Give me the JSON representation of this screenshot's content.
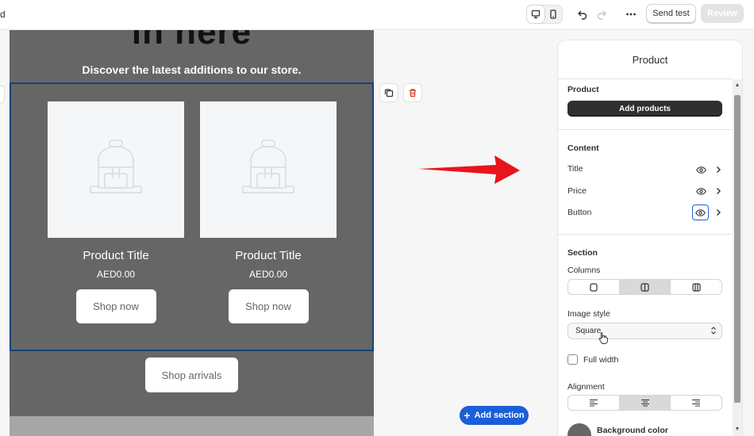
{
  "topbar": {
    "left_fragment": "d",
    "send_test_label": "Send test",
    "review_label": "Review"
  },
  "email": {
    "heading_fragment": "in here",
    "subheading": "Discover the latest additions to our store.",
    "products": [
      {
        "title": "Product Title",
        "price": "AED0.00",
        "button": "Shop now"
      },
      {
        "title": "Product Title",
        "price": "AED0.00",
        "button": "Shop now"
      }
    ],
    "arrivals_button": "Shop arrivals"
  },
  "canvas": {
    "add_section_label": "Add section"
  },
  "panel": {
    "title": "Product",
    "product_section_label": "Product",
    "add_products_label": "Add products",
    "content_section_label": "Content",
    "content_rows": [
      "Title",
      "Price",
      "Button"
    ],
    "section_label": "Section",
    "columns_label": "Columns",
    "columns_selected": 2,
    "image_style_label": "Image style",
    "image_style_value": "Square",
    "full_width_label": "Full width",
    "full_width_checked": false,
    "alignment_label": "Alignment",
    "alignment_selected": "center",
    "background_color_label": "Background color",
    "background_color_value": "#666666"
  },
  "colors": {
    "accent": "#1b5fd6",
    "email_bg": "#666666",
    "arrow": "#e8141c"
  }
}
